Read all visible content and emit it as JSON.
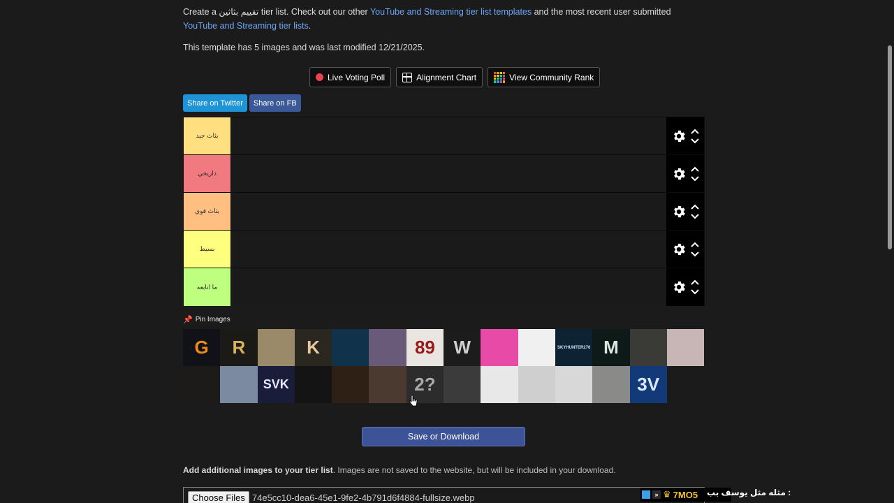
{
  "intro": {
    "prefix": "Create a ",
    "subject": "تقييم بثاثين",
    "mid": " tier list. Check out our other ",
    "link1": "YouTube and Streaming tier list templates",
    "and": " and the most recent user submitted ",
    "link2": "YouTube and Streaming tier lists",
    "end": "."
  },
  "template_info": "This template has 5 images and was last modified 12/21/2025.",
  "tools": {
    "poll": "Live Voting Poll",
    "alignment": "Alignment Chart",
    "community": "View Community Rank"
  },
  "share": {
    "twitter": "Share on Twitter",
    "facebook": "Share on FB"
  },
  "tiers": [
    {
      "label": "بثاث جيد",
      "color": "#ffdf80"
    },
    {
      "label": "داريخي",
      "color": "#f07a80"
    },
    {
      "label": "بثاث قوي",
      "color": "#ffbf80"
    },
    {
      "label": "بسيط",
      "color": "#ffff7f"
    },
    {
      "label": "ما اتابعه",
      "color": "#bfff7f"
    }
  ],
  "pin_label": "Pin Images",
  "pool": [
    {
      "glyph": "G",
      "bg": "#111118",
      "fg": "#f08a1a"
    },
    {
      "glyph": "R",
      "bg": "#1c1a16",
      "fg": "#d7b45a"
    },
    {
      "glyph": "",
      "bg": "#9b8a6a",
      "fg": "#fff"
    },
    {
      "glyph": "K",
      "bg": "#2a2620",
      "fg": "#e8c89a"
    },
    {
      "glyph": "",
      "bg": "#10324a",
      "fg": "#fff"
    },
    {
      "glyph": "",
      "bg": "#6a5a7a",
      "fg": "#fff"
    },
    {
      "glyph": "89",
      "bg": "#e9e5e0",
      "fg": "#9b1a1a"
    },
    {
      "glyph": "W",
      "bg": "#1c1c1c",
      "fg": "#cfcfcf"
    },
    {
      "glyph": "",
      "bg": "#e84aa8",
      "fg": "#fff"
    },
    {
      "glyph": "",
      "bg": "#f0f0f0",
      "fg": "#000"
    },
    {
      "glyph": "SKYHUNTER270",
      "bg": "#0d2233",
      "fg": "#cfe6ff"
    },
    {
      "glyph": "M",
      "bg": "#0e1a18",
      "fg": "#d8e8e0"
    },
    {
      "glyph": "",
      "bg": "#3a3a36",
      "fg": "#fff"
    },
    {
      "glyph": "",
      "bg": "#c8b6b6",
      "fg": "#fff"
    },
    {
      "glyph": "",
      "bg": "#1d1a1a",
      "fg": "#c0222a"
    },
    {
      "glyph": "",
      "bg": "#7b8aa0",
      "fg": "#fff"
    },
    {
      "glyph": "SVK",
      "bg": "#1a1d3a",
      "fg": "#e6e6ff"
    },
    {
      "glyph": "",
      "bg": "#141414",
      "fg": "#fff"
    },
    {
      "glyph": "",
      "bg": "#2e2015",
      "fg": "#c08a5a"
    },
    {
      "glyph": "",
      "bg": "#4a3a30",
      "fg": "#fff"
    },
    {
      "glyph": "2?",
      "bg": "#2c2c2c",
      "fg": "#aaaaaa"
    },
    {
      "glyph": "",
      "bg": "#3b3b3b",
      "fg": "#fff"
    },
    {
      "glyph": "",
      "bg": "#e8e8e8",
      "fg": "#000"
    },
    {
      "glyph": "",
      "bg": "#cfcfcf",
      "fg": "#111"
    },
    {
      "glyph": "",
      "bg": "#d8d8d8",
      "fg": "#111"
    },
    {
      "glyph": "",
      "bg": "#8a8a88",
      "fg": "#fff"
    },
    {
      "glyph": "3V",
      "bg": "#123a78",
      "fg": "#dbe8ff"
    }
  ],
  "save_label": "Save or Download",
  "add_images": {
    "bold": "Add additional images to your tier list",
    "rest": ". Images are not saved to the website, but will be included in your download."
  },
  "file_input": {
    "button": "Choose Files",
    "filename": "74e5cc10-dea6-45e1-9fe2-4b791d6f4884-fullsize.webp"
  },
  "ticker": {
    "code": "7MO5",
    "text": "مثله مثل يوسف بب :"
  }
}
